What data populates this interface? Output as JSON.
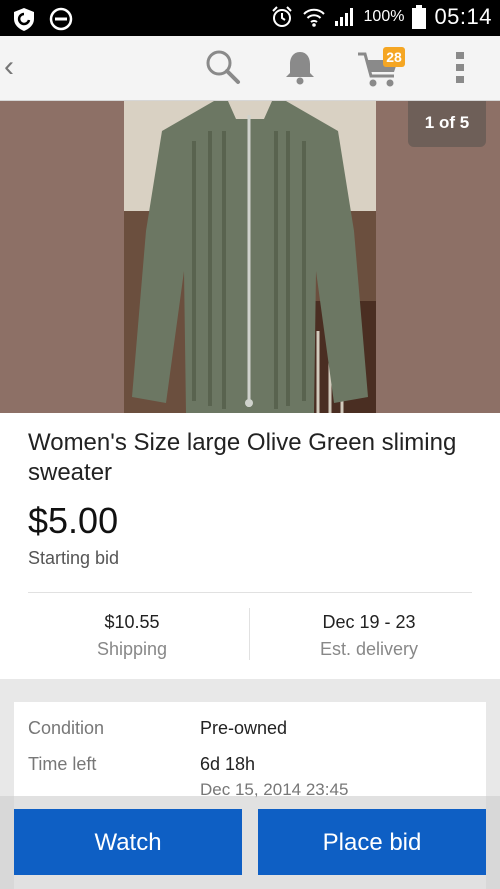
{
  "status_bar": {
    "battery": "100%",
    "time": "05:14"
  },
  "toolbar": {
    "back_icon": "chevron-left-icon",
    "search_icon": "search-icon",
    "notifications_icon": "bell-icon",
    "cart_icon": "cart-icon",
    "cart_count": "28",
    "menu_icon": "more-vertical-icon"
  },
  "gallery": {
    "counter": "1 of 5"
  },
  "listing": {
    "title": "Women's Size large Olive Green sliming sweater",
    "price": "$5.00",
    "price_label": "Starting bid",
    "shipping_value": "$10.55",
    "shipping_label": "Shipping",
    "delivery_value": "Dec 19 - 23",
    "delivery_label": "Est. delivery"
  },
  "details": {
    "condition_label": "Condition",
    "condition_value": "Pre-owned",
    "time_left_label": "Time left",
    "time_left_value": "6d 18h",
    "end_date": "Dec 15, 2014 23:45"
  },
  "actions": {
    "watch": "Watch",
    "place_bid": "Place bid"
  },
  "colors": {
    "accent": "#0e5fc4",
    "badge": "#f5a623"
  }
}
